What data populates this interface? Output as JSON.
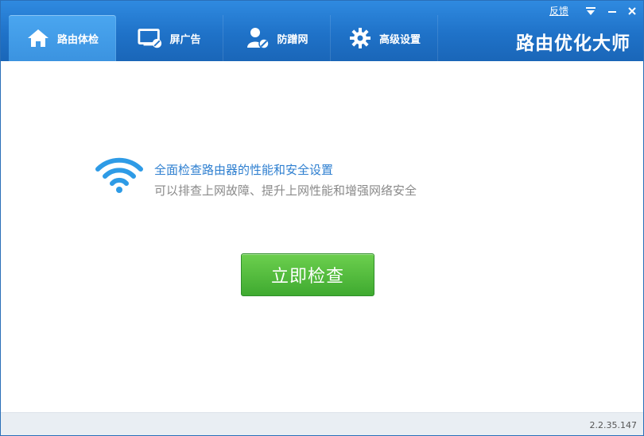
{
  "header": {
    "tabs": [
      {
        "label": "路由体检",
        "icon": "home-icon",
        "active": true
      },
      {
        "label": "屏广告",
        "icon": "monitor-block-icon",
        "active": false
      },
      {
        "label": "防蹭网",
        "icon": "user-block-icon",
        "active": false
      },
      {
        "label": "高级设置",
        "icon": "gear-icon",
        "active": false
      }
    ],
    "brand": "路由优化大师",
    "feedback": "反馈"
  },
  "main": {
    "headline": "全面检查路由器的性能和安全设置",
    "subline": "可以排查上网故障、提升上网性能和增强网络安全",
    "check_button": "立即检查"
  },
  "footer": {
    "version": "2.2.35.147"
  },
  "colors": {
    "header_blue": "#1f72c8",
    "accent_blue": "#2e7fd0",
    "button_green": "#3faa30"
  }
}
